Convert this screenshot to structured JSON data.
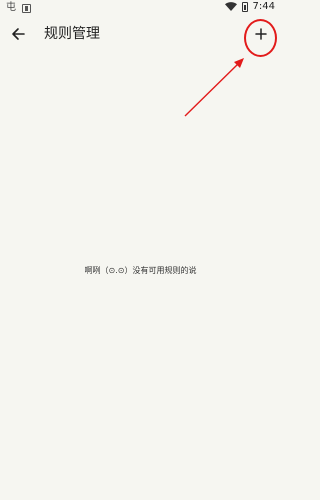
{
  "status_bar": {
    "left_glyph": "屯",
    "time": "7:44"
  },
  "app_bar": {
    "title": "规则管理"
  },
  "main": {
    "empty_message": "啊咧（⊙.⊙）没有可用规则的说"
  },
  "colors": {
    "background": "#f6f6f1",
    "annotation": "#e21b1b"
  },
  "icons": [
    "back-arrow-icon",
    "add-icon",
    "wifi-icon",
    "battery-icon"
  ]
}
